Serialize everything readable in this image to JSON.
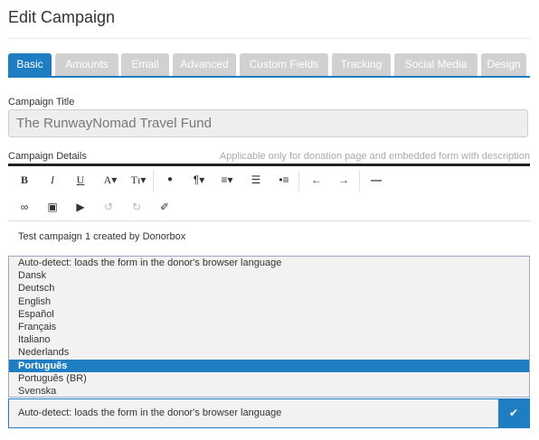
{
  "page": {
    "title": "Edit Campaign"
  },
  "tabs": [
    {
      "label": "Basic",
      "active": true
    },
    {
      "label": "Amounts"
    },
    {
      "label": "Email"
    },
    {
      "label": "Advanced"
    },
    {
      "label": "Custom Fields"
    },
    {
      "label": "Tracking"
    },
    {
      "label": "Social Media"
    },
    {
      "label": "Design"
    }
  ],
  "campaign_title": {
    "label": "Campaign Title",
    "value": "The RunwayNomad Travel Fund"
  },
  "campaign_details": {
    "label": "Campaign Details",
    "hint": "Applicable only for donation page and embedded form with description",
    "content": "Test campaign 1 created by Donorbox"
  },
  "toolbar": {
    "bold": "B",
    "italic": "I",
    "underline": "U",
    "font_color": "A▾",
    "text_size": "Tı▾",
    "color_fill": "●",
    "paragraph": "¶▾",
    "align": "≡▾",
    "ordered_list": "☰",
    "unordered_list": "•≡",
    "outdent": "←",
    "indent": "→",
    "hr": "—",
    "link": "∞",
    "image": "▣",
    "video": "▶",
    "undo": "↺",
    "redo": "↻",
    "eraser": "✐"
  },
  "language": {
    "options": [
      "Auto-detect: loads the form in the donor's browser language",
      "Dansk",
      "Deutsch",
      "English",
      "Español",
      "Français",
      "Italiano",
      "Nederlands",
      "Português",
      "Português (BR)",
      "Svenska"
    ],
    "highlighted": "Português",
    "selected": "Auto-detect: loads the form in the donor's browser language",
    "chevron": "✔"
  },
  "colors": {
    "accent": "#1e7ec1",
    "tab_inactive": "#d1d1d1"
  }
}
